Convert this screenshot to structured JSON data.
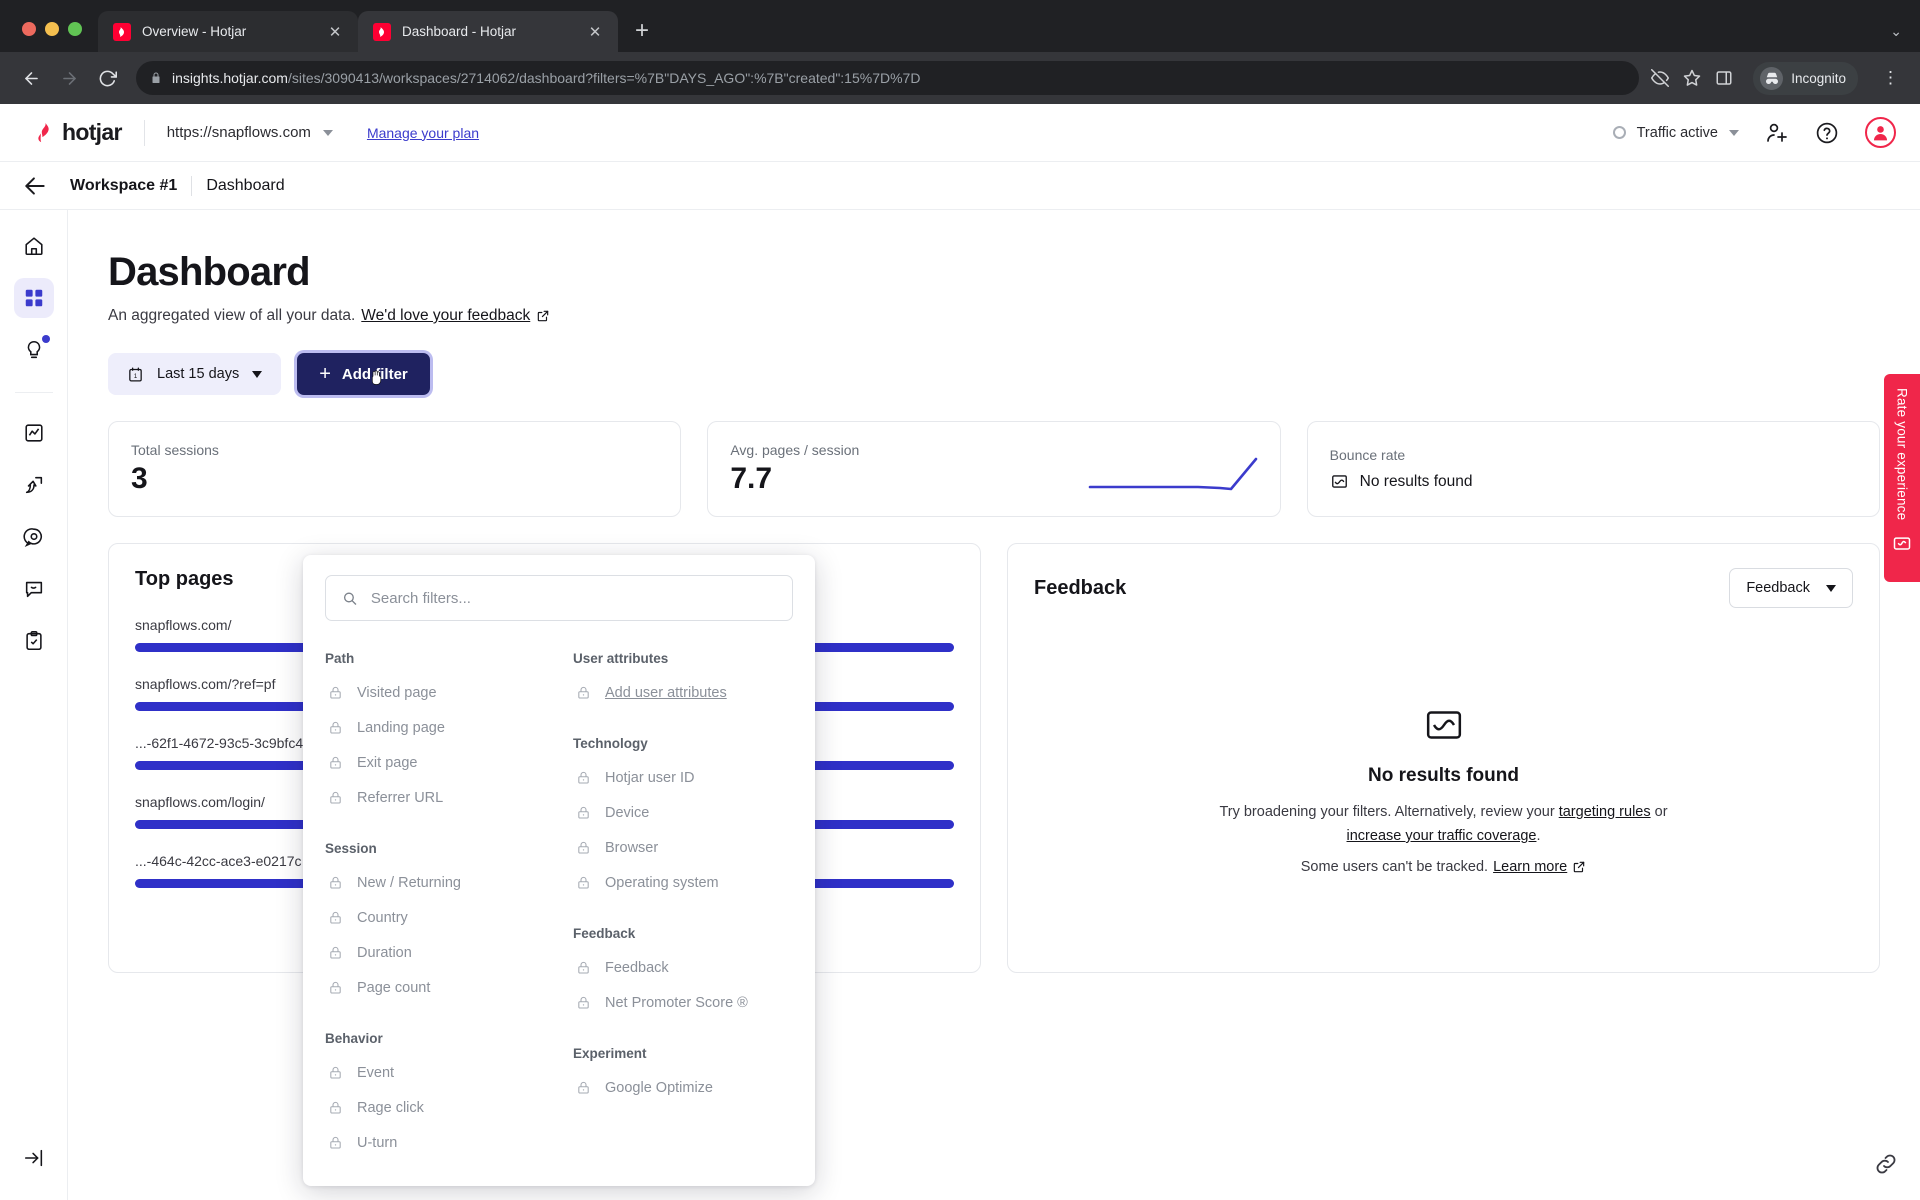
{
  "browser": {
    "tabs": [
      {
        "title": "Overview - Hotjar",
        "active": false
      },
      {
        "title": "Dashboard - Hotjar",
        "active": true
      }
    ],
    "new_tab_label": "+",
    "url_secure": "insights.hotjar.com",
    "url_path": "/sites/3090413/workspaces/2714062/dashboard?filters=%7B\"DAYS_AGO\":%7B\"created\":15%7D%7D",
    "profile_label": "Incognito"
  },
  "app_header": {
    "brand": "hotjar",
    "site": "https://snapflows.com",
    "manage_plan": "Manage your plan",
    "traffic_status": "Traffic active"
  },
  "breadcrumb": {
    "workspace": "Workspace #1",
    "current": "Dashboard"
  },
  "sidebar": {
    "items": [
      {
        "name": "home",
        "label": "Home",
        "active": false,
        "badge": false
      },
      {
        "name": "dashboard",
        "label": "Dashboard",
        "active": true,
        "badge": false
      },
      {
        "name": "highlights",
        "label": "Highlights",
        "active": false,
        "badge": true
      },
      {
        "name": "trends",
        "label": "Trends",
        "active": false,
        "badge": false
      },
      {
        "name": "funnels",
        "label": "Funnels",
        "active": false,
        "badge": false
      },
      {
        "name": "heatmaps",
        "label": "Heatmaps",
        "active": false,
        "badge": false
      },
      {
        "name": "feedback",
        "label": "Feedback",
        "active": false,
        "badge": false
      },
      {
        "name": "surveys",
        "label": "Surveys",
        "active": false,
        "badge": false
      }
    ],
    "collapse_label": "Expand"
  },
  "page": {
    "title": "Dashboard",
    "subtitle": "An aggregated view of all your data.",
    "feedback_link": "We'd love your feedback"
  },
  "controls": {
    "date_range": "Last 15 days",
    "add_filter": "Add filter"
  },
  "metrics": [
    {
      "label": "Total sessions",
      "value": "3",
      "has_spark": true
    },
    {
      "label": "Avg. pages / session",
      "value": "7.7",
      "has_spark": true
    },
    {
      "label": "Bounce rate",
      "value": "No results found",
      "has_spark": false
    }
  ],
  "top_pages": {
    "title": "Top pages",
    "rows": [
      {
        "label": "snapflows.com/",
        "pct": 100
      },
      {
        "label": "snapflows.com/?ref=pf",
        "pct": 100
      },
      {
        "label": "...-62f1-4672-93c5-3c9bfc4",
        "pct": 100
      },
      {
        "label": "snapflows.com/login/",
        "pct": 100
      },
      {
        "label": "...-464c-42cc-ace3-e0217c",
        "pct": 100
      }
    ]
  },
  "feedback_panel": {
    "title": "Feedback",
    "dropdown": "Feedback",
    "empty_title": "No results found",
    "empty_line1_a": "Try broadening your filters. Alternatively, review your",
    "empty_link1": "targeting rules",
    "empty_line1_b": "or",
    "empty_link2": "increase your traffic coverage",
    "empty_line1_c": ".",
    "empty_line2": "Some users can't be tracked.",
    "empty_link3": "Learn more"
  },
  "filter_popup": {
    "search_placeholder": "Search filters...",
    "search_value": "",
    "columns": [
      {
        "groups": [
          {
            "title": "Path",
            "items": [
              "Visited page",
              "Landing page",
              "Exit page",
              "Referrer URL"
            ]
          },
          {
            "title": "Session",
            "items": [
              "New / Returning",
              "Country",
              "Duration",
              "Page count"
            ]
          },
          {
            "title": "Behavior",
            "items": [
              "Event",
              "Rage click",
              "U-turn"
            ]
          }
        ]
      },
      {
        "groups": [
          {
            "title": "User attributes",
            "items": [
              "Add user attributes"
            ],
            "link": true
          },
          {
            "title": "Technology",
            "items": [
              "Hotjar user ID",
              "Device",
              "Browser",
              "Operating system"
            ]
          },
          {
            "title": "Feedback",
            "items": [
              "Feedback",
              "Net Promoter Score ®"
            ]
          },
          {
            "title": "Experiment",
            "items": [
              "Google Optimize"
            ]
          }
        ]
      }
    ]
  },
  "rate_widget": {
    "label": "Rate your experience"
  },
  "colors": {
    "accent": "#3b3bcc",
    "bar": "#2f30c8",
    "brand_red": "#f0264a",
    "button": "#1f2260"
  }
}
